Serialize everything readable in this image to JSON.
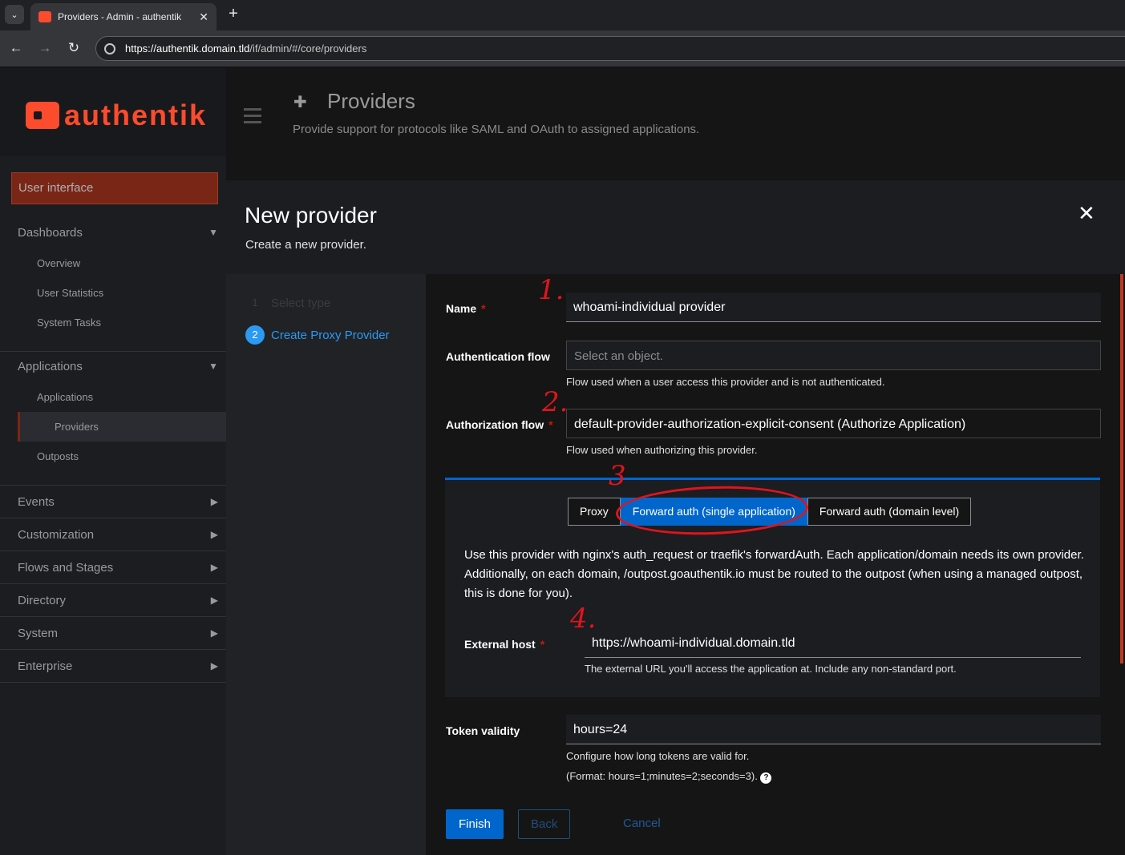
{
  "browser": {
    "tab_title": "Providers - Admin - authentik",
    "url_host": "https://authentik.domain.tld",
    "url_path": "/if/admin/#/core/providers"
  },
  "sidebar": {
    "logo_text": "authentik",
    "user_interface": "User interface",
    "dashboards": {
      "label": "Dashboards",
      "items": [
        "Overview",
        "User Statistics",
        "System Tasks"
      ]
    },
    "applications": {
      "label": "Applications",
      "items": [
        "Applications",
        "Providers",
        "Outposts"
      ]
    },
    "sections": [
      "Events",
      "Customization",
      "Flows and Stages",
      "Directory",
      "System",
      "Enterprise"
    ]
  },
  "page": {
    "title": "Providers",
    "description": "Provide support for protocols like SAML and OAuth to assigned applications."
  },
  "modal": {
    "title": "New provider",
    "subtitle": "Create a new provider.",
    "steps": [
      {
        "num": "1",
        "label": "Select type"
      },
      {
        "num": "2",
        "label": "Create Proxy Provider"
      }
    ],
    "name": {
      "label": "Name",
      "required": "*",
      "value": "whoami-individual provider"
    },
    "auth_flow": {
      "label": "Authentication flow",
      "placeholder": "Select an object.",
      "help": "Flow used when a user access this provider and is not authenticated."
    },
    "authz_flow": {
      "label": "Authorization flow",
      "required": "*",
      "value": "default-provider-authorization-explicit-consent (Authorize Application)",
      "help": "Flow used when authorizing this provider."
    },
    "modes": [
      "Proxy",
      "Forward auth (single application)",
      "Forward auth (domain level)"
    ],
    "mode_desc": "Use this provider with nginx's auth_request or traefik's forwardAuth. Each application/domain needs its own provider. Additionally, on each domain, /outpost.goauthentik.io must be routed to the outpost (when using a managed outpost, this is done for you).",
    "external_host": {
      "label": "External host",
      "required": "*",
      "value": "https://whoami-individual.domain.tld",
      "help": "The external URL you'll access the application at. Include any non-standard port."
    },
    "token_validity": {
      "label": "Token validity",
      "value": "hours=24",
      "help1": "Configure how long tokens are valid for.",
      "help2": "(Format: hours=1;minutes=2;seconds=3)."
    },
    "buttons": {
      "finish": "Finish",
      "back": "Back",
      "cancel": "Cancel"
    }
  },
  "annotations": [
    "1.",
    "2.",
    "3",
    "4."
  ]
}
